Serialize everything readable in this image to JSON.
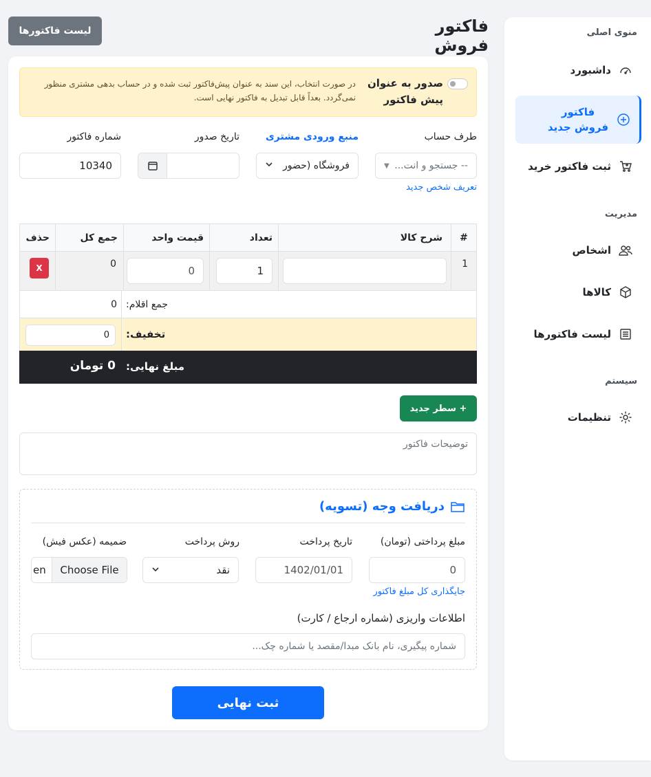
{
  "sidebar": {
    "section_main": "منوی اصلی",
    "items_main": [
      {
        "label": "داشبورد",
        "icon": "gauge-icon"
      },
      {
        "label": "فاکتور فروش جدید",
        "icon": "plus-circle-icon"
      },
      {
        "label": "ثبت فاکتور خرید",
        "icon": "cart-plus-icon"
      }
    ],
    "section_manage": "مدیریت",
    "items_manage": [
      {
        "label": "اشخاص",
        "icon": "people-icon"
      },
      {
        "label": "کالاها",
        "icon": "box-icon"
      },
      {
        "label": "لیست فاکتورها",
        "icon": "list-icon"
      }
    ],
    "section_system": "سیستم",
    "items_system": [
      {
        "label": "تنظیمات",
        "icon": "gear-icon"
      }
    ]
  },
  "header": {
    "title": "فاکتور فروش",
    "list_button": "لیست فاکتورها"
  },
  "alert": {
    "title": "صدور به عنوان پیش فاکتور",
    "text": "در صورت انتخاب، این سند به عنوان پیش‌فاکتور ثبت شده و در حساب بدهی مشتری منظور نمی‌گردد. بعداً قابل تبدیل به فاکتور نهایی است."
  },
  "form": {
    "account_label": "طرف حساب",
    "account_placeholder": "-- جستجو و انت...",
    "new_person_link": "تعریف شخص جدید",
    "source_label": "منبع ورودی مشتری",
    "source_value": "فروشگاه (حضور",
    "date_label": "تاریخ صدور",
    "number_label": "شماره فاکتور",
    "number_value": "10340"
  },
  "table": {
    "headers": {
      "index": "#",
      "desc": "شرح کالا",
      "qty": "تعداد",
      "unit_price": "قیمت واحد",
      "total": "جمع کل",
      "delete": "حذف"
    },
    "rows": [
      {
        "index": "1",
        "desc": "",
        "qty": "1",
        "unit_price": "0",
        "total": "0",
        "delete": "X"
      }
    ],
    "sum_label": "جمع اقلام:",
    "sum_value": "0",
    "discount_label": "تخفیف:",
    "discount_value": "0",
    "final_label": "مبلغ نهایی:",
    "final_value": "0 تومان"
  },
  "add_row_button": "+ سطر جدید",
  "notes_placeholder": "توضیحات فاکتور",
  "payment": {
    "title": "دریافت وجه (تسویه)",
    "amount_label": "مبلغ پرداختی (تومان)",
    "amount_value": "0",
    "fill_link": "جایگذاری کل مبلغ فاکتور",
    "date_label": "تاریخ پرداخت",
    "date_value": "1402/01/01",
    "method_label": "روش پرداخت",
    "method_value": "نقد",
    "attach_label": "ضمیمه (عکس فیش)",
    "attach_button": "Choose File",
    "attach_status": "en",
    "info_label": "اطلاعات واریزی (شماره ارجاع / کارت)",
    "info_placeholder": "شماره پیگیری، نام بانک مبدا/مقصد یا شماره چک..."
  },
  "submit_button": "ثبت نهایی"
}
